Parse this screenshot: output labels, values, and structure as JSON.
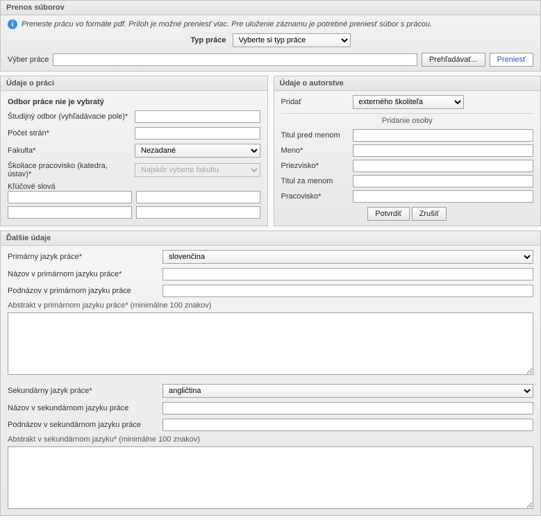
{
  "transfer": {
    "title": "Prenos súborov",
    "info": "Preneste prácu vo formáte pdf. Príloh je možné preniesť viac. Pre uloženie záznamu je potrebné preniesť súbor s prácou.",
    "typeLabel": "Typ práce",
    "typeValue": "Vyberte si typ práce",
    "chooseLabel": "Výber práce",
    "browse": "Prehľadávať...",
    "upload": "Preniesť"
  },
  "work": {
    "title": "Údaje o práci",
    "branchNotSelected": "Odbor práce nie je vybratý",
    "studyField": "Študijný odbor (vyhľadávacie pole)*",
    "pages": "Počet strán*",
    "faculty": "Fakulta*",
    "facultyValue": "Nezadané",
    "department": "Školiace pracovisko (katedra, ústav)*",
    "departmentPlaceholder": "Najskôr vyberte fakultu",
    "keywords": "Kľúčové slová"
  },
  "author": {
    "title": "Údaje o autorstve",
    "add": "Pridať",
    "addValue": "externého školiteľa",
    "personHeader": "Pridanie osoby",
    "titleBefore": "Titul pred menom",
    "firstName": "Meno*",
    "lastName": "Priezvisko*",
    "titleAfter": "Titul za menom",
    "workplace": "Pracovisko*",
    "confirm": "Potvrdiť",
    "cancel": "Zrušiť"
  },
  "other": {
    "title": "Ďalšie údaje",
    "primaryLang": "Primárny jazyk práce*",
    "primaryLangValue": "slovenčina",
    "titlePrimary": "Názov v primárnom jazyku práce*",
    "subtitlePrimary": "Podnázov v primárnom jazyku práce",
    "abstractPrimary": "Abstrakt v primárnom jazyku práce* (minimálne 100 znakov)",
    "secondaryLang": "Sekundárny jazyk práce*",
    "secondaryLangValue": "angličtina",
    "titleSecondary": "Názov v sekundárnom jazyku práce",
    "subtitleSecondary": "Podnázov v sekundárnom jazyku práce",
    "abstractSecondary": "Abstrakt v sekundárnom jazyku* (minimálne 100 znakov)"
  }
}
